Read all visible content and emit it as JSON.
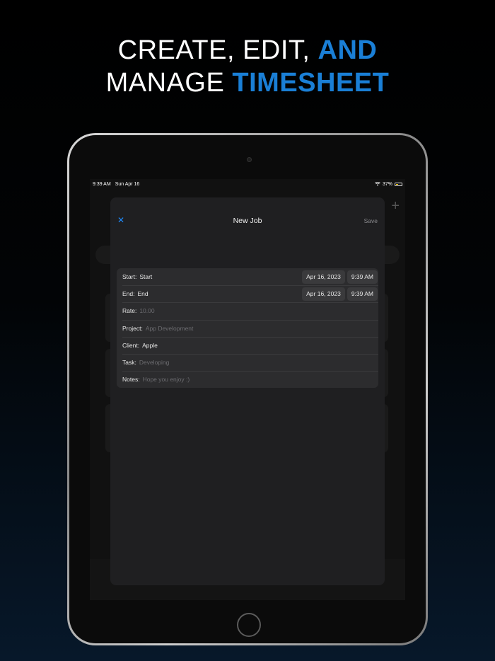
{
  "headline": {
    "line1_plain": "CREATE, EDIT, ",
    "line1_accent": "AND",
    "line2_plain": "MANAGE ",
    "line2_accent": "TIMESHEET"
  },
  "statusbar": {
    "time": "9:39 AM",
    "date": "Sun Apr 16",
    "battery": "37%"
  },
  "sheet": {
    "close_icon": "close-icon",
    "title": "New Job",
    "save_label": "Save"
  },
  "form": {
    "start": {
      "label": "Start:",
      "value": "Start",
      "date": "Apr 16, 2023",
      "time": "9:39 AM"
    },
    "end": {
      "label": "End:",
      "value": "End",
      "date": "Apr 16, 2023",
      "time": "9:39 AM"
    },
    "rate": {
      "label": "Rate:",
      "placeholder": "10.00"
    },
    "project": {
      "label": "Project:",
      "placeholder": "App Development"
    },
    "client": {
      "label": "Client:",
      "value": "Apple"
    },
    "task": {
      "label": "Task:",
      "placeholder": "Developing"
    },
    "notes": {
      "label": "Notes:",
      "placeholder": "Hope you enjoy :)"
    }
  },
  "colors": {
    "accent": "#1a7fd6",
    "link": "#1e8cff",
    "sheet_bg": "#1f1f21",
    "form_bg": "#2c2c2e"
  }
}
